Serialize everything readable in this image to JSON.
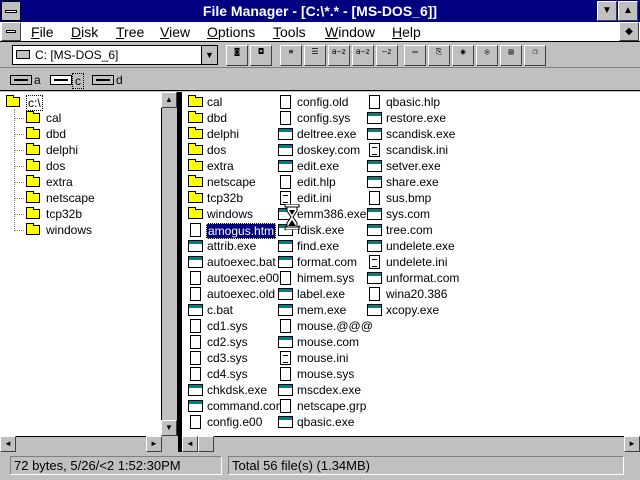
{
  "window": {
    "title": "File Manager - [C:\\*.* - [MS-DOS_6]]",
    "minimize_glyph": "▼",
    "maximize_glyph": "▲",
    "restore_glyph": "◆"
  },
  "menu": {
    "items": [
      {
        "key": "F",
        "rest": "ile"
      },
      {
        "key": "D",
        "rest": "isk"
      },
      {
        "key": "T",
        "rest": "ree"
      },
      {
        "key": "V",
        "rest": "iew"
      },
      {
        "key": "O",
        "rest": "ptions"
      },
      {
        "key": "T",
        "rest": "ools"
      },
      {
        "key": "W",
        "rest": "indow"
      },
      {
        "key": "H",
        "rest": "elp"
      }
    ]
  },
  "toolbar": {
    "drive_selector": "C: [MS-DOS_6]",
    "dropdown_glyph": "▼",
    "buttons": [
      {
        "name": "connect-network-drive-button",
        "glyph": "◙"
      },
      {
        "name": "disconnect-network-drive-button",
        "glyph": "◘"
      },
      {
        "name": "view-name-button",
        "glyph": "≡"
      },
      {
        "name": "view-all-details-button",
        "glyph": "☰"
      },
      {
        "name": "sort-by-name-button",
        "glyph": "a‒z"
      },
      {
        "name": "sort-by-type-button",
        "glyph": "a‒z"
      },
      {
        "name": "sort-by-size-button",
        "glyph": "‒z"
      },
      {
        "name": "sort-by-date-button",
        "glyph": "▭"
      },
      {
        "name": "copy-to-clipboard-button",
        "glyph": "⎘"
      },
      {
        "name": "share-as-button",
        "glyph": "◉"
      },
      {
        "name": "stop-sharing-button",
        "glyph": "◎"
      },
      {
        "name": "properties-button",
        "glyph": "▤"
      },
      {
        "name": "new-window-button",
        "glyph": "❐"
      }
    ]
  },
  "drives": [
    {
      "letter": "a"
    },
    {
      "letter": "c"
    },
    {
      "letter": "d"
    }
  ],
  "tree": {
    "root": "c:\\",
    "folders": [
      "cal",
      "dbd",
      "delphi",
      "dos",
      "extra",
      "netscape",
      "tcp32b",
      "windows"
    ]
  },
  "files": {
    "columns": [
      [
        {
          "name": "cal",
          "type": "folder"
        },
        {
          "name": "dbd",
          "type": "folder"
        },
        {
          "name": "delphi",
          "type": "folder"
        },
        {
          "name": "dos",
          "type": "folder"
        },
        {
          "name": "extra",
          "type": "folder"
        },
        {
          "name": "netscape",
          "type": "folder"
        },
        {
          "name": "tcp32b",
          "type": "folder"
        },
        {
          "name": "windows",
          "type": "folder"
        },
        {
          "name": "amogus.htm",
          "type": "doc",
          "selected": true
        },
        {
          "name": "attrib.exe",
          "type": "exe"
        },
        {
          "name": "autoexec.bat",
          "type": "exe"
        },
        {
          "name": "autoexec.e00",
          "type": "doc"
        },
        {
          "name": "autoexec.old",
          "type": "doc"
        },
        {
          "name": "c.bat",
          "type": "exe"
        },
        {
          "name": "cd1.sys",
          "type": "doc"
        },
        {
          "name": "cd2.sys",
          "type": "doc"
        },
        {
          "name": "cd3.sys",
          "type": "doc"
        },
        {
          "name": "cd4.sys",
          "type": "doc"
        },
        {
          "name": "chkdsk.exe",
          "type": "exe"
        },
        {
          "name": "command.com",
          "type": "exe"
        },
        {
          "name": "config.e00",
          "type": "doc"
        }
      ],
      [
        {
          "name": "config.old",
          "type": "doc"
        },
        {
          "name": "config.sys",
          "type": "doc"
        },
        {
          "name": "deltree.exe",
          "type": "exe"
        },
        {
          "name": "doskey.com",
          "type": "exe"
        },
        {
          "name": "edit.exe",
          "type": "exe"
        },
        {
          "name": "edit.hlp",
          "type": "doc"
        },
        {
          "name": "edit.ini",
          "type": "text"
        },
        {
          "name": "emm386.exe",
          "type": "exe"
        },
        {
          "name": "fdisk.exe",
          "type": "exe"
        },
        {
          "name": "find.exe",
          "type": "exe"
        },
        {
          "name": "format.com",
          "type": "exe"
        },
        {
          "name": "himem.sys",
          "type": "doc"
        },
        {
          "name": "label.exe",
          "type": "exe"
        },
        {
          "name": "mem.exe",
          "type": "exe"
        },
        {
          "name": "mouse.@@@",
          "type": "doc"
        },
        {
          "name": "mouse.com",
          "type": "exe"
        },
        {
          "name": "mouse.ini",
          "type": "text"
        },
        {
          "name": "mouse.sys",
          "type": "doc"
        },
        {
          "name": "mscdex.exe",
          "type": "exe"
        },
        {
          "name": "netscape.grp",
          "type": "doc"
        },
        {
          "name": "qbasic.exe",
          "type": "exe"
        }
      ],
      [
        {
          "name": "qbasic.hlp",
          "type": "doc"
        },
        {
          "name": "restore.exe",
          "type": "exe"
        },
        {
          "name": "scandisk.exe",
          "type": "exe"
        },
        {
          "name": "scandisk.ini",
          "type": "text"
        },
        {
          "name": "setver.exe",
          "type": "exe"
        },
        {
          "name": "share.exe",
          "type": "exe"
        },
        {
          "name": "sus.bmp",
          "type": "doc"
        },
        {
          "name": "sys.com",
          "type": "exe"
        },
        {
          "name": "tree.com",
          "type": "exe"
        },
        {
          "name": "undelete.exe",
          "type": "exe"
        },
        {
          "name": "undelete.ini",
          "type": "text"
        },
        {
          "name": "unformat.com",
          "type": "exe"
        },
        {
          "name": "wina20.386",
          "type": "doc"
        },
        {
          "name": "xcopy.exe",
          "type": "exe"
        }
      ]
    ]
  },
  "scroll_glyphs": {
    "up": "▲",
    "down": "▼",
    "left": "◄",
    "right": "►"
  },
  "status": {
    "selection": "72 bytes, 5/26/<2 1:52:30PM",
    "total": "Total 56 file(s) (1.34MB)"
  }
}
